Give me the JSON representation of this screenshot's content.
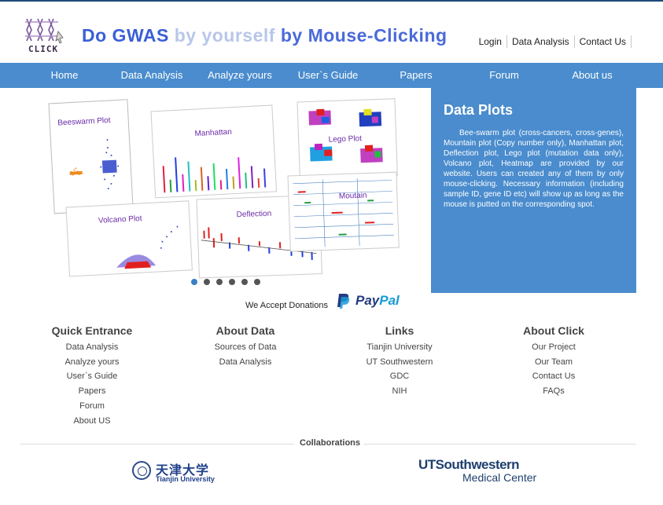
{
  "header": {
    "logo_text": "CLICK",
    "title_part1": "Do GWAS",
    "title_part2": " by yourself",
    "title_part3": " by Mouse-Clicking",
    "top_links": [
      "Login",
      "Data Analysis",
      "Contact Us"
    ]
  },
  "nav": {
    "items": [
      "Home",
      "Data Analysis",
      "Analyze yours",
      "User`s Guide",
      "Papers",
      "Forum",
      "About us"
    ]
  },
  "slide": {
    "labels": [
      "Beeswarm Plot",
      "Manhattan",
      "Lego Plot",
      "Volcano Plot",
      "Deflection",
      "Moutain"
    ],
    "dot_count": 6,
    "active_dot": 0
  },
  "panel": {
    "title": "Data Plots",
    "body": "Bee-swarm plot (cross-cancers, cross-genes), Mountain plot (Copy number only), Manhattan plot, Deflection plot, Lego plot (mutation data only), Volcano plot, Heatmap are provided by our website. Users can created any of them by only mouse-clicking. Necessary information (including sample ID, gene ID etc) will show up as long as the mouse is putted on the corresponding spot."
  },
  "donations": {
    "text": "We Accept Donations",
    "paypal_pay": "Pay",
    "paypal_pal": "Pal"
  },
  "footer": {
    "quick": {
      "title": "Quick Entrance",
      "links": [
        "Data Analysis",
        "Analyze yours",
        "User`s Guide",
        "Papers",
        "Forum",
        "About US"
      ]
    },
    "about_data": {
      "title": "About Data",
      "links": [
        "Sources of Data",
        "Data Analysis"
      ]
    },
    "links": {
      "title": "Links",
      "links": [
        "Tianjin University",
        "UT Southwestern",
        "GDC",
        "NIH"
      ]
    },
    "about_click": {
      "title": "About Click",
      "links": [
        "Our Project",
        "Our Team",
        "Contact Us",
        "FAQs"
      ]
    }
  },
  "collaborations": {
    "label": "Collaborations",
    "tju_cn": "天津大学",
    "tju_en": "Tianjin University",
    "utsw_line1": "UTSouthwestern",
    "utsw_line2": "Medical Center"
  },
  "colors": {
    "nav_bg": "#4a8ccd",
    "title_blue": "#3b5fd6",
    "paypal_dark": "#253b80",
    "paypal_light": "#179bd7"
  }
}
